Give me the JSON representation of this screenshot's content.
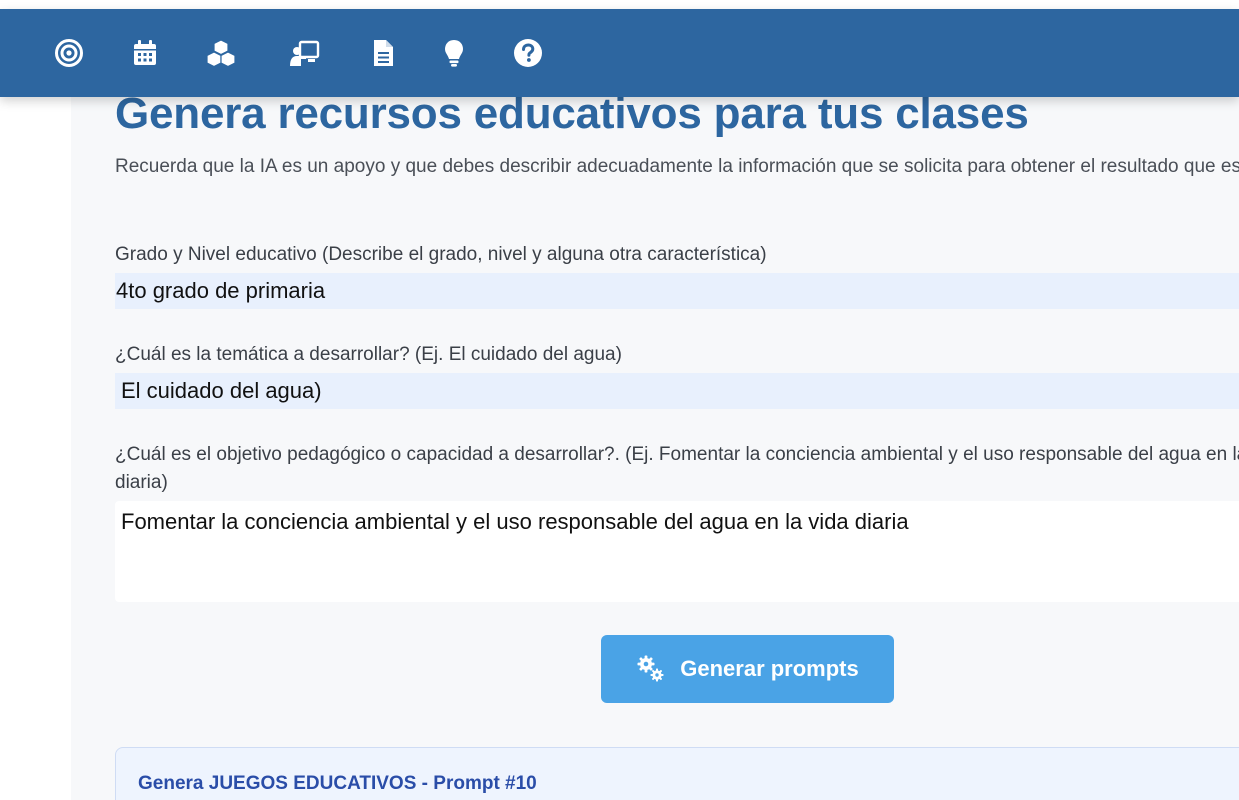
{
  "nav": {
    "icons": [
      "target-icon",
      "calendar-icon",
      "cubes-icon",
      "teacher-board-icon",
      "document-icon",
      "lightbulb-icon",
      "help-icon"
    ]
  },
  "header": {
    "title": "Genera recursos educativos para tus clases",
    "subtitle": "Recuerda que la IA es un apoyo y que debes describir adecuadamente la información que se solicita para obtener el resultado que esperas."
  },
  "form": {
    "grade_label": "Grado y Nivel educativo (Describe el grado, nivel y alguna otra característica)",
    "grade_value": "4to grado de primaria",
    "topic_label": "¿Cuál es la temática a desarrollar? (Ej. El cuidado del agua)",
    "topic_value": "El cuidado del agua)",
    "objective_label": "¿Cuál es el objetivo pedagógico o capacidad a desarrollar?. (Ej. Fomentar la conciencia ambiental y el uso responsable del agua en la vida diaria)",
    "objective_value": "Fomentar la conciencia ambiental y el uso responsable del agua en la vida diaria"
  },
  "actions": {
    "generate_label": "Generar prompts",
    "generate_icon": "gears-icon"
  },
  "result_card": {
    "title": "Genera JUEGOS EDUCATIVOS - Prompt #10"
  },
  "colors": {
    "navbar": "#2d66a0",
    "title": "#2d66a0",
    "button": "#4aa3e6",
    "input_bg": "#e8f0fd",
    "card_title": "#2a4da8"
  }
}
